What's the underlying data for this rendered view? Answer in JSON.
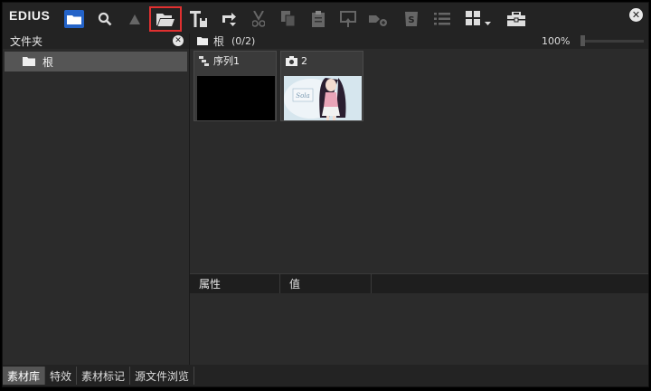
{
  "app": {
    "logo": "EDIUS"
  },
  "toolbar": {
    "buttons": [
      "search-icon",
      "triangle-up-icon",
      "open-folder-icon",
      "add-text-icon",
      "replace-icon",
      "cut-icon",
      "copy-icon",
      "paste-icon",
      "export-icon",
      "add-to-timeline-icon",
      "refresh-icon",
      "list-view-icon",
      "grid-view-icon",
      "toolbox-icon"
    ],
    "active_color": "#2463c8",
    "highlight_color": "#e03030"
  },
  "left_panel": {
    "title": "文件夹",
    "folders": [
      {
        "label": "根"
      }
    ]
  },
  "bin": {
    "path_label": "根",
    "count": "(0/2)",
    "zoom": "100%",
    "clips": [
      {
        "label": "序列1",
        "kind": "sequence-icon"
      },
      {
        "label": "2",
        "kind": "camera-icon"
      }
    ]
  },
  "properties": {
    "col_property": "属性",
    "col_value": "值"
  },
  "bottom_tabs": [
    {
      "label": "素材库",
      "active": true
    },
    {
      "label": "特效",
      "active": false
    },
    {
      "label": "素材标记",
      "active": false
    },
    {
      "label": "源文件浏览",
      "active": false
    }
  ]
}
